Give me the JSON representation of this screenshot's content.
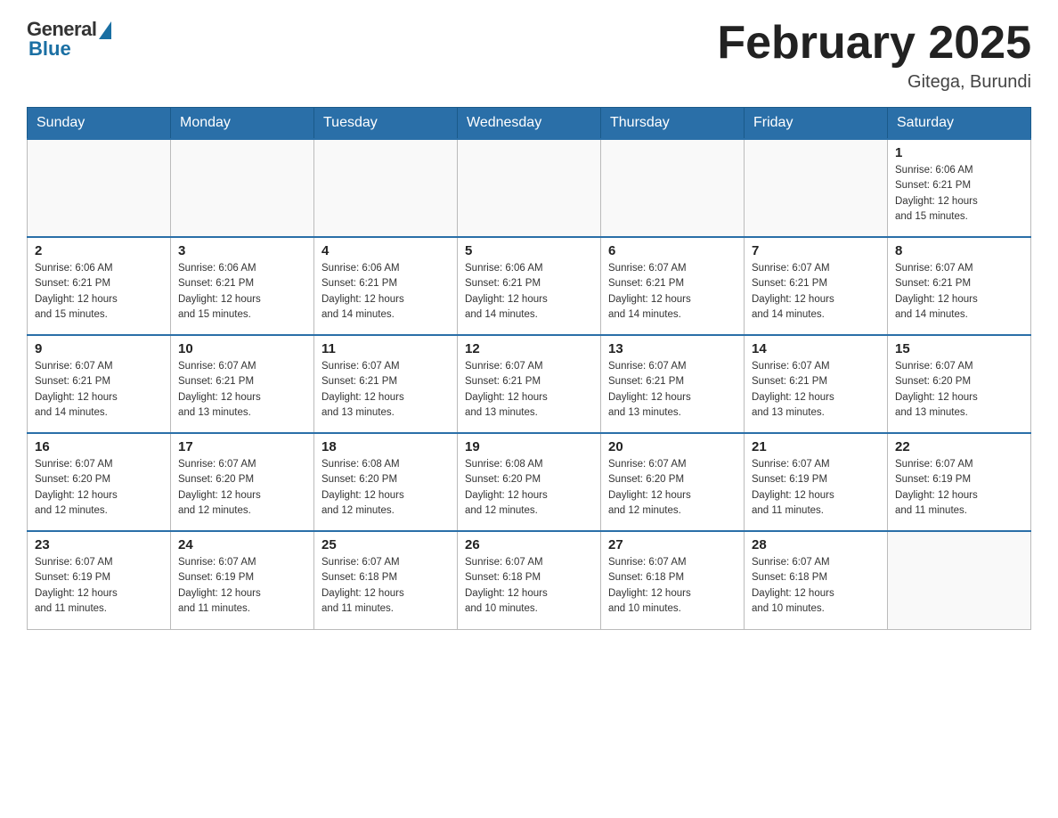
{
  "header": {
    "logo_general": "General",
    "logo_blue": "Blue",
    "month_title": "February 2025",
    "location": "Gitega, Burundi"
  },
  "days_of_week": [
    "Sunday",
    "Monday",
    "Tuesday",
    "Wednesday",
    "Thursday",
    "Friday",
    "Saturday"
  ],
  "weeks": [
    [
      {
        "day": "",
        "info": ""
      },
      {
        "day": "",
        "info": ""
      },
      {
        "day": "",
        "info": ""
      },
      {
        "day": "",
        "info": ""
      },
      {
        "day": "",
        "info": ""
      },
      {
        "day": "",
        "info": ""
      },
      {
        "day": "1",
        "info": "Sunrise: 6:06 AM\nSunset: 6:21 PM\nDaylight: 12 hours\nand 15 minutes."
      }
    ],
    [
      {
        "day": "2",
        "info": "Sunrise: 6:06 AM\nSunset: 6:21 PM\nDaylight: 12 hours\nand 15 minutes."
      },
      {
        "day": "3",
        "info": "Sunrise: 6:06 AM\nSunset: 6:21 PM\nDaylight: 12 hours\nand 15 minutes."
      },
      {
        "day": "4",
        "info": "Sunrise: 6:06 AM\nSunset: 6:21 PM\nDaylight: 12 hours\nand 14 minutes."
      },
      {
        "day": "5",
        "info": "Sunrise: 6:06 AM\nSunset: 6:21 PM\nDaylight: 12 hours\nand 14 minutes."
      },
      {
        "day": "6",
        "info": "Sunrise: 6:07 AM\nSunset: 6:21 PM\nDaylight: 12 hours\nand 14 minutes."
      },
      {
        "day": "7",
        "info": "Sunrise: 6:07 AM\nSunset: 6:21 PM\nDaylight: 12 hours\nand 14 minutes."
      },
      {
        "day": "8",
        "info": "Sunrise: 6:07 AM\nSunset: 6:21 PM\nDaylight: 12 hours\nand 14 minutes."
      }
    ],
    [
      {
        "day": "9",
        "info": "Sunrise: 6:07 AM\nSunset: 6:21 PM\nDaylight: 12 hours\nand 14 minutes."
      },
      {
        "day": "10",
        "info": "Sunrise: 6:07 AM\nSunset: 6:21 PM\nDaylight: 12 hours\nand 13 minutes."
      },
      {
        "day": "11",
        "info": "Sunrise: 6:07 AM\nSunset: 6:21 PM\nDaylight: 12 hours\nand 13 minutes."
      },
      {
        "day": "12",
        "info": "Sunrise: 6:07 AM\nSunset: 6:21 PM\nDaylight: 12 hours\nand 13 minutes."
      },
      {
        "day": "13",
        "info": "Sunrise: 6:07 AM\nSunset: 6:21 PM\nDaylight: 12 hours\nand 13 minutes."
      },
      {
        "day": "14",
        "info": "Sunrise: 6:07 AM\nSunset: 6:21 PM\nDaylight: 12 hours\nand 13 minutes."
      },
      {
        "day": "15",
        "info": "Sunrise: 6:07 AM\nSunset: 6:20 PM\nDaylight: 12 hours\nand 13 minutes."
      }
    ],
    [
      {
        "day": "16",
        "info": "Sunrise: 6:07 AM\nSunset: 6:20 PM\nDaylight: 12 hours\nand 12 minutes."
      },
      {
        "day": "17",
        "info": "Sunrise: 6:07 AM\nSunset: 6:20 PM\nDaylight: 12 hours\nand 12 minutes."
      },
      {
        "day": "18",
        "info": "Sunrise: 6:08 AM\nSunset: 6:20 PM\nDaylight: 12 hours\nand 12 minutes."
      },
      {
        "day": "19",
        "info": "Sunrise: 6:08 AM\nSunset: 6:20 PM\nDaylight: 12 hours\nand 12 minutes."
      },
      {
        "day": "20",
        "info": "Sunrise: 6:07 AM\nSunset: 6:20 PM\nDaylight: 12 hours\nand 12 minutes."
      },
      {
        "day": "21",
        "info": "Sunrise: 6:07 AM\nSunset: 6:19 PM\nDaylight: 12 hours\nand 11 minutes."
      },
      {
        "day": "22",
        "info": "Sunrise: 6:07 AM\nSunset: 6:19 PM\nDaylight: 12 hours\nand 11 minutes."
      }
    ],
    [
      {
        "day": "23",
        "info": "Sunrise: 6:07 AM\nSunset: 6:19 PM\nDaylight: 12 hours\nand 11 minutes."
      },
      {
        "day": "24",
        "info": "Sunrise: 6:07 AM\nSunset: 6:19 PM\nDaylight: 12 hours\nand 11 minutes."
      },
      {
        "day": "25",
        "info": "Sunrise: 6:07 AM\nSunset: 6:18 PM\nDaylight: 12 hours\nand 11 minutes."
      },
      {
        "day": "26",
        "info": "Sunrise: 6:07 AM\nSunset: 6:18 PM\nDaylight: 12 hours\nand 10 minutes."
      },
      {
        "day": "27",
        "info": "Sunrise: 6:07 AM\nSunset: 6:18 PM\nDaylight: 12 hours\nand 10 minutes."
      },
      {
        "day": "28",
        "info": "Sunrise: 6:07 AM\nSunset: 6:18 PM\nDaylight: 12 hours\nand 10 minutes."
      },
      {
        "day": "",
        "info": ""
      }
    ]
  ]
}
